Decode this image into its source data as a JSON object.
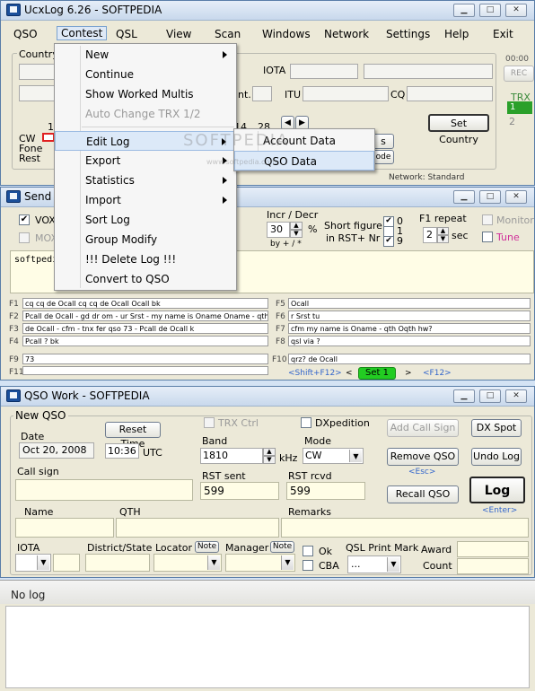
{
  "main_window": {
    "title": "UcxLog 6.26  - SOFTPEDIA",
    "menu": [
      "QSO",
      "Contest",
      "QSL",
      "View",
      "Scan",
      "Windows",
      "Network",
      "Settings",
      "Help",
      "Exit"
    ],
    "labels": {
      "country": "Country",
      "iota": "IOTA",
      "itu": "ITU",
      "cq": "CQ",
      "cont": "nt.",
      "cw": "CW",
      "fone": "Fone",
      "rest": "Rest",
      "num1": "1",
      "num14": "14",
      "num28": "28",
      "trx": "TRX",
      "trx1": "1",
      "trx2": "2",
      "reset_time": "00:00",
      "rec": "REC",
      "s_btn": "s",
      "ode_btn": "ode",
      "network_status": "Network: Standard"
    },
    "set_country_button": "Set Country"
  },
  "contest_menu": {
    "items": [
      {
        "label": "New",
        "submenu": true,
        "disabled": false
      },
      {
        "label": "Continue",
        "submenu": false,
        "disabled": false
      },
      {
        "label": "Show Worked Multis",
        "submenu": false,
        "disabled": false
      },
      {
        "label": "Auto Change TRX 1/2",
        "submenu": false,
        "disabled": true
      },
      {
        "label": "Edit Log",
        "submenu": true,
        "disabled": false
      },
      {
        "label": "Export",
        "submenu": true,
        "disabled": false
      },
      {
        "label": "Statistics",
        "submenu": true,
        "disabled": false
      },
      {
        "label": "Import",
        "submenu": true,
        "disabled": false
      },
      {
        "label": "Sort Log",
        "submenu": false,
        "disabled": false
      },
      {
        "label": "Group Modify",
        "submenu": false,
        "disabled": false
      },
      {
        "label": "!!! Delete Log !!!",
        "submenu": false,
        "disabled": false
      },
      {
        "label": "Convert to QSO",
        "submenu": false,
        "disabled": false
      }
    ]
  },
  "edit_log_submenu": {
    "items": [
      "Account Data",
      "QSO Data"
    ]
  },
  "watermark": "SOFTPEDIA",
  "watermark_url": "www.softpedia.com",
  "send_window": {
    "title": "Send CW",
    "vox": "VOX",
    "mox": "MOX",
    "incr_decr": "Incr / Decr",
    "speed": "30",
    "percent": "%",
    "by": "by + / *",
    "short_figure": "Short figure",
    "in_rst": "in RST+ Nr",
    "digits": [
      "0",
      "1",
      "9"
    ],
    "f1_repeat": "F1 repeat",
    "repeat_value": "2",
    "sec": "sec",
    "monitor": "Monitor",
    "tune": "Tune",
    "text": "softpedia",
    "fkeys_left": [
      {
        "key": "F1",
        "text": "cq cq de Ocall cq cq de Ocall Ocall bk"
      },
      {
        "key": "F2",
        "text": "Pcall de Ocall - gd dr om - ur Srst - my name is Oname Oname - qth Oqth Oqth - hw? - Pcall de Ocall k"
      },
      {
        "key": "F3",
        "text": "de Ocall - cfm - tnx fer qso 73 - Pcall de Ocall k"
      },
      {
        "key": "F4",
        "text": "Pcall ? bk"
      },
      {
        "key": "F9",
        "text": "73"
      },
      {
        "key": "F11",
        "text": ""
      }
    ],
    "fkeys_right": [
      {
        "key": "F5",
        "text": "Ocall"
      },
      {
        "key": "F6",
        "text": "r Srst tu"
      },
      {
        "key": "F7",
        "text": "cfm my name is Oname - qth Oqth hw?"
      },
      {
        "key": "F8",
        "text": "qsl via ?"
      },
      {
        "key": "F10",
        "text": "qrz? de Ocall"
      }
    ],
    "shift_f12": "<Shift+F12>",
    "set1": "Set 1",
    "f12": "<F12>"
  },
  "qso_window": {
    "title": "QSO Work - SOFTPEDIA",
    "group": "New QSO",
    "reset_time": "Reset Time",
    "trx_ctrl": "TRX Ctrl",
    "dxpedition": "DXpedition",
    "add_call_sign": "Add Call Sign",
    "dx_spot": "DX Spot",
    "date_label": "Date",
    "date": "Oct 20, 2008",
    "time": "10:36",
    "utc": "UTC",
    "band_label": "Band",
    "band": "1810",
    "khz": "kHz",
    "mode_label": "Mode",
    "mode": "CW",
    "remove_qso": "Remove QSO",
    "esc_hint": "<Esc>",
    "undo_log": "Undo Log",
    "call_sign": "Call sign",
    "rst_sent_label": "RST sent",
    "rst_sent": "599",
    "rst_rcvd_label": "RST rcvd",
    "rst_rcvd": "599",
    "recall_qso": "Recall QSO",
    "log": "Log",
    "enter_hint": "<Enter>",
    "name": "Name",
    "qth": "QTH",
    "remarks": "Remarks",
    "iota": "IOTA",
    "district": "District/State",
    "locator": "Locator",
    "note": "Note",
    "manager": "Manager",
    "ok": "Ok",
    "cba": "CBA",
    "qsl_print_mark": "QSL Print Mark",
    "qsl_value": "...",
    "award": "Award",
    "count": "Count"
  },
  "log_panel": {
    "text": "No log"
  }
}
